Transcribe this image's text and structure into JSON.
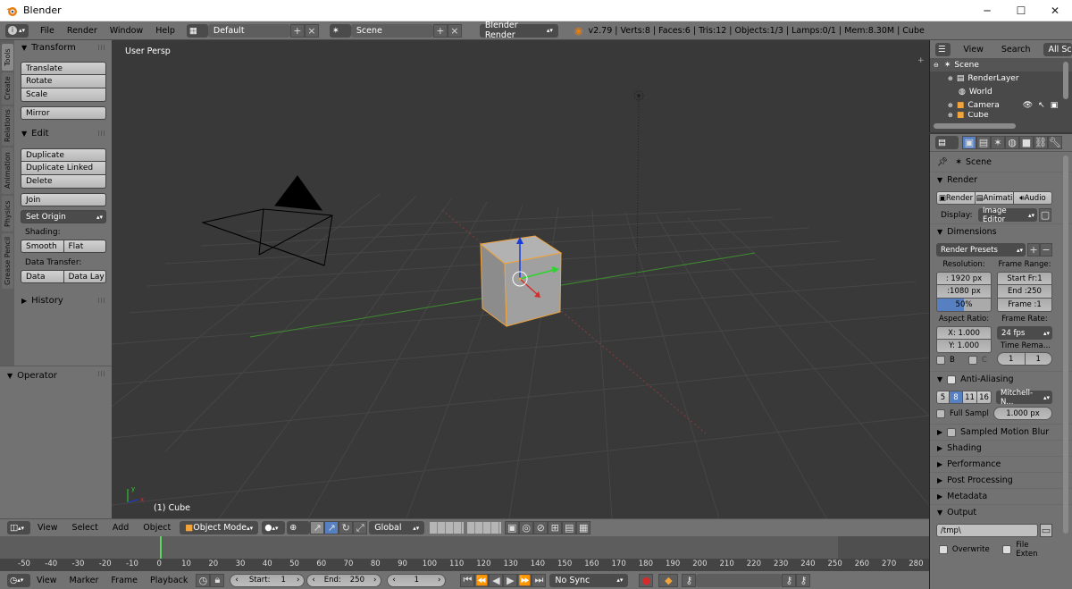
{
  "window": {
    "title": "Blender",
    "min": "─",
    "max": "☐",
    "close": "✕"
  },
  "info_header": {
    "menus": [
      "File",
      "Render",
      "Window",
      "Help"
    ],
    "layout": "Default",
    "scene": "Scene",
    "engine": "Blender Render",
    "stats": "v2.79 | Verts:8 | Faces:6 | Tris:12 | Objects:1/3 | Lamps:0/1 | Mem:8.30M | Cube"
  },
  "toolshelf": {
    "tabs": [
      "Tools",
      "Create",
      "Relations",
      "Animation",
      "Physics",
      "Grease Pencil"
    ],
    "transform": {
      "title": "Transform",
      "buttons": [
        "Translate",
        "Rotate",
        "Scale"
      ],
      "mirror": "Mirror"
    },
    "edit": {
      "title": "Edit",
      "buttons": [
        "Duplicate",
        "Duplicate Linked",
        "Delete"
      ],
      "join": "Join",
      "set_origin": "Set Origin",
      "shading_label": "Shading:",
      "smooth": "Smooth",
      "flat": "Flat",
      "data_transfer_label": "Data Transfer:",
      "data": "Data",
      "data_lay": "Data Lay"
    },
    "history": "History",
    "operator": "Operator"
  },
  "viewport": {
    "view_label": "User Persp",
    "object_label": "(1) Cube"
  },
  "view3d_header": {
    "menus": [
      "View",
      "Select",
      "Add",
      "Object"
    ],
    "mode": "Object Mode",
    "orientation": "Global"
  },
  "timeline": {
    "ticks": [
      "-50",
      "-40",
      "-30",
      "-20",
      "-10",
      "0",
      "10",
      "20",
      "30",
      "40",
      "50",
      "60",
      "70",
      "80",
      "90",
      "100",
      "110",
      "120",
      "130",
      "140",
      "150",
      "160",
      "170",
      "180",
      "190",
      "200",
      "210",
      "220",
      "230",
      "240",
      "250",
      "260",
      "270",
      "280"
    ],
    "menus": [
      "View",
      "Marker",
      "Frame",
      "Playback"
    ],
    "start": "Start:",
    "start_val": "1",
    "end": "End:",
    "end_val": "250",
    "current": "1",
    "sync": "No Sync"
  },
  "outliner": {
    "menus": [
      "View",
      "Search"
    ],
    "filter": "All Scenes",
    "items": [
      "Scene",
      "RenderLayer",
      "World",
      "Camera",
      "Cube"
    ]
  },
  "properties": {
    "context": "Scene",
    "render": {
      "title": "Render",
      "btn_render": "Render",
      "btn_anim": "Animati",
      "btn_audio": "Audio",
      "display_label": "Display:",
      "display_val": "Image Editor"
    },
    "dimensions": {
      "title": "Dimensions",
      "presets": "Render Presets",
      "resolution_label": "Resolution:",
      "res_x": ": 1920 px",
      "res_y": ":1080 px",
      "res_pct": "50%",
      "frame_range_label": "Frame Range:",
      "start": "Start Fr:1",
      "end": "End :250",
      "frame": "Frame :1",
      "aspect_label": "Aspect Ratio:",
      "asp_x": "X:  1.000",
      "asp_y": "Y:  1.000",
      "frame_rate_label": "Frame Rate:",
      "fps": "24 fps",
      "b": "B",
      "c": "C",
      "time_remap": "Time Rema...",
      "tr_old": "1",
      "tr_new": "1"
    },
    "aa": {
      "title": "Anti-Aliasing",
      "samples": [
        "5",
        "8",
        "11",
        "16"
      ],
      "filter": "Mitchell-N...",
      "full_sample": "Full Sampl",
      "size": "1.000 px"
    },
    "collapsed": [
      "Sampled Motion Blur",
      "Shading",
      "Performance",
      "Post Processing",
      "Metadata"
    ],
    "output": {
      "title": "Output",
      "path": "/tmp\\",
      "overwrite": "Overwrite",
      "file_ext": "File Exten"
    }
  },
  "colors": {
    "accent": "#5680c2",
    "selected_orange": "#f2a33a",
    "bg_dark": "#393939",
    "panel": "#727272"
  }
}
